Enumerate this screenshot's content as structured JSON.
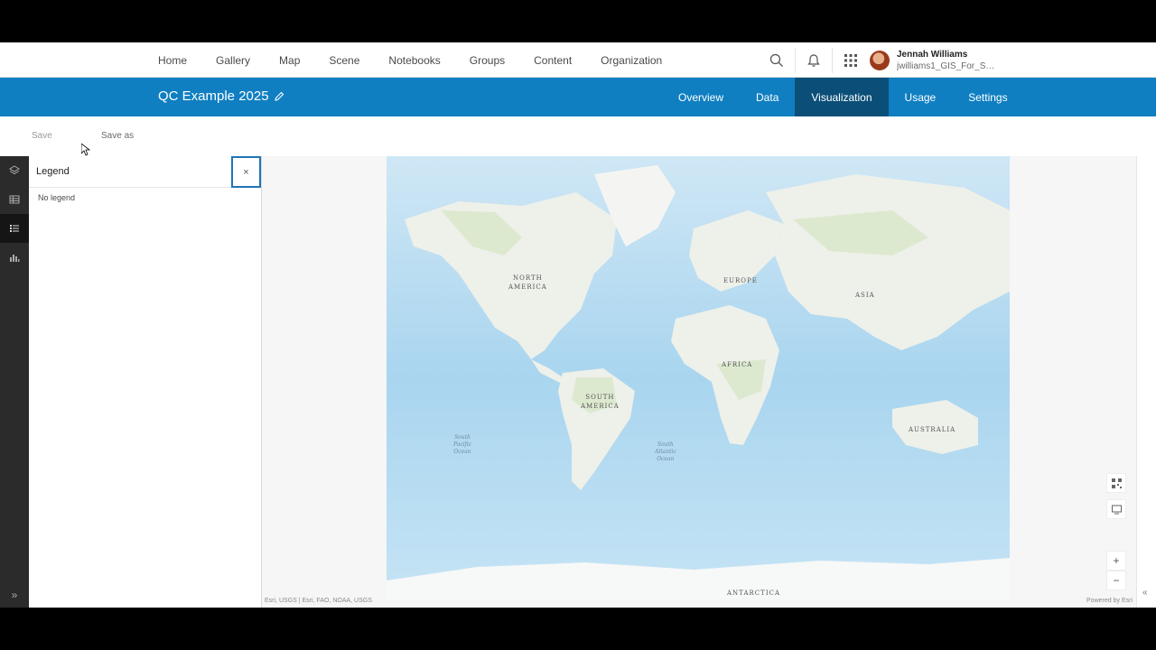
{
  "topnav": {
    "links": [
      "Home",
      "Gallery",
      "Map",
      "Scene",
      "Notebooks",
      "Groups",
      "Content",
      "Organization"
    ],
    "icons": [
      "search-icon",
      "bell-icon",
      "apps-grid-icon"
    ],
    "user": {
      "name": "Jennah Williams",
      "username": "jwilliams1_GIS_For_Sch..."
    }
  },
  "header": {
    "title": "QC Example 2025",
    "tabs": [
      "Overview",
      "Data",
      "Visualization",
      "Usage",
      "Settings"
    ],
    "active_tab": "Visualization",
    "accent_color": "#0f7fc1",
    "active_tab_color": "#0b4f78"
  },
  "toolbar": {
    "save_label": "Save",
    "save_as_label": "Save as"
  },
  "rail": {
    "icons": [
      "layers-icon",
      "table-icon",
      "legend-icon",
      "chart-icon"
    ],
    "active": "legend-icon",
    "expand_glyph": "»"
  },
  "legend": {
    "title": "Legend",
    "close_glyph": "×",
    "empty_text": "No legend"
  },
  "map": {
    "continents": {
      "north_america": [
        "NORTH",
        "AMERICA"
      ],
      "south_america": [
        "SOUTH",
        "AMERICA"
      ],
      "europe": "EUROPE",
      "asia": "ASIA",
      "africa": "AFRICA",
      "australia": "AUSTRALIA",
      "antarctica": "ANTARCTICA"
    },
    "oceans": {
      "south_pacific": [
        "South",
        "Pacific",
        "Ocean"
      ],
      "south_atlantic": [
        "South",
        "Atlantic",
        "Ocean"
      ]
    },
    "attribution": "Esri, USGS | Esri, FAO, NOAA, USGS",
    "powered_by": "Powered by Esri",
    "controls": {
      "zoom_in": "+",
      "zoom_out": "−",
      "collapse": "«"
    }
  }
}
